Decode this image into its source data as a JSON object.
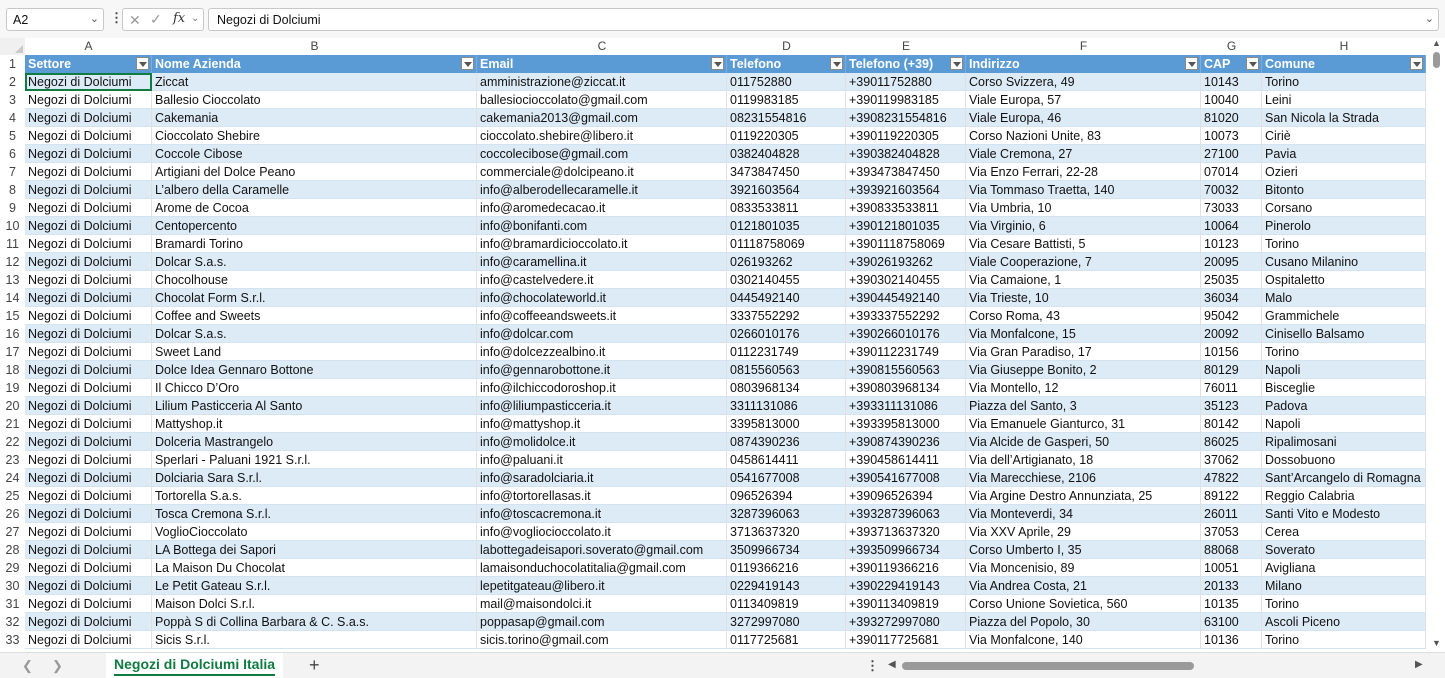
{
  "formula_bar": {
    "cell_ref": "A2",
    "fx": "fx",
    "content": "Negozi di Dolciumi"
  },
  "columns": [
    "A",
    "B",
    "C",
    "D",
    "E",
    "F",
    "G",
    "H"
  ],
  "headers": [
    "Settore",
    "Nome Azienda",
    "Email",
    "Telefono",
    "Telefono (+39)",
    "Indirizzo",
    "CAP",
    "Comune"
  ],
  "rows": [
    [
      "Negozi di Dolciumi",
      "Ziccat",
      "amministrazione@ziccat.it",
      "011752880",
      "+39011752880",
      "Corso Svizzera, 49",
      "10143",
      "Torino"
    ],
    [
      "Negozi di Dolciumi",
      "Ballesio Cioccolato",
      "ballesiocioccolato@gmail.com",
      "0119983185",
      "+390119983185",
      "Viale Europa, 57",
      "10040",
      "Leini"
    ],
    [
      "Negozi di Dolciumi",
      "Cakemania",
      "cakemania2013@gmail.com",
      "08231554816",
      "+3908231554816",
      "Viale Europa, 46",
      "81020",
      "San Nicola la Strada"
    ],
    [
      "Negozi di Dolciumi",
      "Cioccolato Shebire",
      "cioccolato.shebire@libero.it",
      "0119220305",
      "+390119220305",
      "Corso Nazioni Unite, 83",
      "10073",
      "Ciriè"
    ],
    [
      "Negozi di Dolciumi",
      "Coccole Cibose",
      "coccolecibose@gmail.com",
      "0382404828",
      "+390382404828",
      "Viale Cremona, 27",
      "27100",
      "Pavia"
    ],
    [
      "Negozi di Dolciumi",
      "Artigiani del Dolce Peano",
      "commerciale@dolcipeano.it",
      "3473847450",
      "+393473847450",
      "Via Enzo Ferrari, 22-28",
      "07014",
      "Ozieri"
    ],
    [
      "Negozi di Dolciumi",
      "L’albero della Caramelle",
      "info@alberodellecaramelle.it",
      "3921603564",
      "+393921603564",
      "Via Tommaso Traetta, 140",
      "70032",
      "Bitonto"
    ],
    [
      "Negozi di Dolciumi",
      "Arome de Cocoa",
      "info@aromedecacao.it",
      "0833533811",
      "+390833533811",
      "Via Umbria, 10",
      "73033",
      "Corsano"
    ],
    [
      "Negozi di Dolciumi",
      "Centopercento",
      "info@bonifanti.com",
      "0121801035",
      "+390121801035",
      "Via Virginio, 6",
      "10064",
      "Pinerolo"
    ],
    [
      "Negozi di Dolciumi",
      "Bramardi Torino",
      "info@bramardicioccolato.it",
      "01118758069",
      "+3901118758069",
      "Via Cesare Battisti, 5",
      "10123",
      "Torino"
    ],
    [
      "Negozi di Dolciumi",
      "Dolcar S.a.s.",
      "info@caramellina.it",
      "026193262",
      "+39026193262",
      "Viale Cooperazione, 7",
      "20095",
      "Cusano Milanino"
    ],
    [
      "Negozi di Dolciumi",
      "Chocolhouse",
      "info@castelvedere.it",
      "0302140455",
      "+390302140455",
      "Via Camaione, 1",
      "25035",
      "Ospitaletto"
    ],
    [
      "Negozi di Dolciumi",
      "Chocolat Form S.r.l.",
      "info@chocolateworld.it",
      "0445492140",
      "+390445492140",
      "Via Trieste, 10",
      "36034",
      "Malo"
    ],
    [
      "Negozi di Dolciumi",
      "Coffee and Sweets",
      "info@coffeeandsweets.it",
      "3337552292",
      "+393337552292",
      "Corso Roma, 43",
      "95042",
      "Grammichele"
    ],
    [
      "Negozi di Dolciumi",
      "Dolcar S.a.s.",
      "info@dolcar.com",
      "0266010176",
      "+390266010176",
      "Via Monfalcone, 15",
      "20092",
      "Cinisello Balsamo"
    ],
    [
      "Negozi di Dolciumi",
      "Sweet Land",
      "info@dolcezzealbino.it",
      "0112231749",
      "+390112231749",
      "Via Gran Paradiso, 17",
      "10156",
      "Torino"
    ],
    [
      "Negozi di Dolciumi",
      "Dolce Idea Gennaro Bottone",
      "info@gennarobottone.it",
      "0815560563",
      "+390815560563",
      "Via Giuseppe Bonito, 2",
      "80129",
      "Napoli"
    ],
    [
      "Negozi di Dolciumi",
      "Il Chicco D’Oro",
      "info@ilchiccodoroshop.it",
      "0803968134",
      "+390803968134",
      "Via Montello, 12",
      "76011",
      "Bisceglie"
    ],
    [
      "Negozi di Dolciumi",
      "Lilium Pasticceria Al Santo",
      "info@liliumpasticceria.it",
      "3311131086",
      "+393311131086",
      "Piazza del Santo, 3",
      "35123",
      "Padova"
    ],
    [
      "Negozi di Dolciumi",
      "Mattyshop.it",
      "info@mattyshop.it",
      "3395813000",
      "+393395813000",
      "Via Emanuele Gianturco, 31",
      "80142",
      "Napoli"
    ],
    [
      "Negozi di Dolciumi",
      "Dolceria Mastrangelo",
      "info@molidolce.it",
      "0874390236",
      "+390874390236",
      "Via Alcide de Gasperi, 50",
      "86025",
      "Ripalimosani"
    ],
    [
      "Negozi di Dolciumi",
      "Sperlari - Paluani 1921 S.r.l.",
      "info@paluani.it",
      "0458614411",
      "+390458614411",
      "Via dell’Artigianato, 18",
      "37062",
      "Dossobuono"
    ],
    [
      "Negozi di Dolciumi",
      "Dolciaria Sara S.r.l.",
      "info@saradolciaria.it",
      "0541677008",
      "+390541677008",
      "Via Marecchiese, 2106",
      "47822",
      "Sant’Arcangelo di Romagna"
    ],
    [
      "Negozi di Dolciumi",
      "Tortorella S.a.s.",
      "info@tortorellasas.it",
      "096526394",
      "+39096526394",
      "Via Argine Destro Annunziata, 25",
      "89122",
      "Reggio Calabria"
    ],
    [
      "Negozi di Dolciumi",
      "Tosca Cremona S.r.l.",
      "info@toscacremona.it",
      "3287396063",
      "+393287396063",
      "Via Monteverdi, 34",
      "26011",
      "Santi Vito e Modesto"
    ],
    [
      "Negozi di Dolciumi",
      "VoglioCioccolato",
      "info@vogliocioccolato.it",
      "3713637320",
      "+393713637320",
      "Via XXV Aprile, 29",
      "37053",
      "Cerea"
    ],
    [
      "Negozi di Dolciumi",
      "LA Bottega dei Sapori",
      "labottegadeisapori.soverato@gmail.com",
      "3509966734",
      "+393509966734",
      "Corso Umberto I, 35",
      "88068",
      "Soverato"
    ],
    [
      "Negozi di Dolciumi",
      "La Maison Du Chocolat",
      "lamaisonduchocolatitalia@gmail.com",
      "0119366216",
      "+390119366216",
      "Via Moncenisio, 89",
      "10051",
      "Avigliana"
    ],
    [
      "Negozi di Dolciumi",
      "Le Petit Gateau S.r.l.",
      "lepetitgateau@libero.it",
      "0229419143",
      "+390229419143",
      "Via Andrea Costa, 21",
      "20133",
      "Milano"
    ],
    [
      "Negozi di Dolciumi",
      "Maison Dolci S.r.l.",
      "mail@maisondolci.it",
      "0113409819",
      "+390113409819",
      "Corso Unione Sovietica, 560",
      "10135",
      "Torino"
    ],
    [
      "Negozi di Dolciumi",
      "Poppà S di Collina Barbara & C. S.a.s.",
      "poppasap@gmail.com",
      "3272997080",
      "+393272997080",
      "Piazza del Popolo, 30",
      "63100",
      "Ascoli Piceno"
    ],
    [
      "Negozi di Dolciumi",
      "Sicis S.r.l.",
      "sicis.torino@gmail.com",
      "0117725681",
      "+390117725681",
      "Via Monfalcone, 140",
      "10136",
      "Torino"
    ]
  ],
  "row_numbers": [
    "1",
    "2",
    "3",
    "4",
    "5",
    "6",
    "7",
    "8",
    "9",
    "10",
    "11",
    "12",
    "13",
    "14",
    "15",
    "16",
    "17",
    "18",
    "19",
    "20",
    "21",
    "22",
    "23",
    "24",
    "25",
    "26",
    "27",
    "28",
    "29",
    "30",
    "31",
    "32",
    "33"
  ],
  "sheet_tab": "Negozi di Dolciumi Italia",
  "add_sheet_label": "+",
  "colors": {
    "header_bg": "#5b9bd5",
    "band": "#ddebf7",
    "accent": "#107c41"
  },
  "icons": {
    "cancel": "close-icon",
    "enter": "check-icon",
    "fx": "function-icon",
    "namebox_caret": "chevron-down-icon",
    "expand": "chevron-down-icon",
    "filter": "filter-dropdown-icon",
    "prev": "chevron-left-icon",
    "next": "chevron-right-icon"
  }
}
